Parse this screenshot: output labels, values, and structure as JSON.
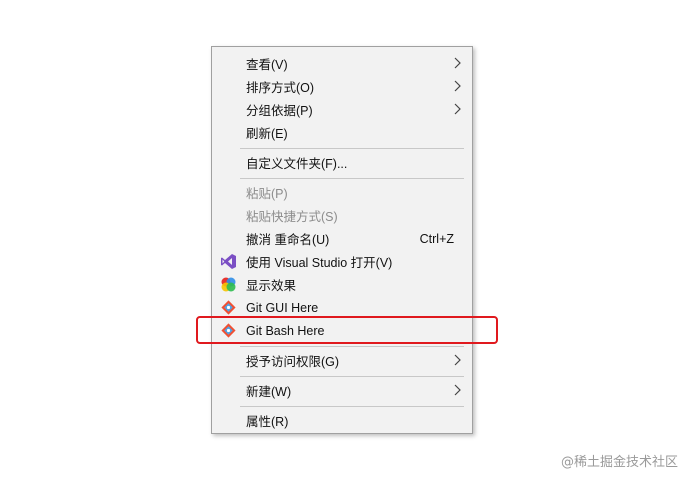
{
  "menu": {
    "items": [
      {
        "label": "查看(V)",
        "submenu": true,
        "disabled": false
      },
      {
        "label": "排序方式(O)",
        "submenu": true,
        "disabled": false
      },
      {
        "label": "分组依据(P)",
        "submenu": true,
        "disabled": false
      },
      {
        "label": "刷新(E)",
        "submenu": false,
        "disabled": false
      },
      {
        "label": "自定义文件夹(F)...",
        "submenu": false,
        "disabled": false
      },
      {
        "label": "粘贴(P)",
        "submenu": false,
        "disabled": true
      },
      {
        "label": "粘贴快捷方式(S)",
        "submenu": false,
        "disabled": true
      },
      {
        "label": "撤消 重命名(U)",
        "shortcut": "Ctrl+Z",
        "submenu": false,
        "disabled": false
      },
      {
        "label": "使用 Visual Studio 打开(V)",
        "icon": "visual-studio-icon",
        "submenu": false,
        "disabled": false
      },
      {
        "label": "显示效果",
        "icon": "display-effects-icon",
        "submenu": false,
        "disabled": false
      },
      {
        "label": "Git GUI Here",
        "icon": "git-icon",
        "submenu": false,
        "disabled": false
      },
      {
        "label": "Git Bash Here",
        "icon": "git-icon",
        "submenu": false,
        "disabled": false,
        "highlighted": true
      },
      {
        "label": "授予访问权限(G)",
        "submenu": true,
        "disabled": false
      },
      {
        "label": "新建(W)",
        "submenu": true,
        "disabled": false
      },
      {
        "label": "属性(R)",
        "submenu": false,
        "disabled": false
      }
    ]
  },
  "colors": {
    "menu_background": "#f2f2f2",
    "highlight_border": "#e0191e",
    "disabled_text": "#8c8c8c",
    "git_orange": "#f05033",
    "visual_studio_purple": "#7b4fc4"
  },
  "watermark": "@稀土掘金技术社区"
}
